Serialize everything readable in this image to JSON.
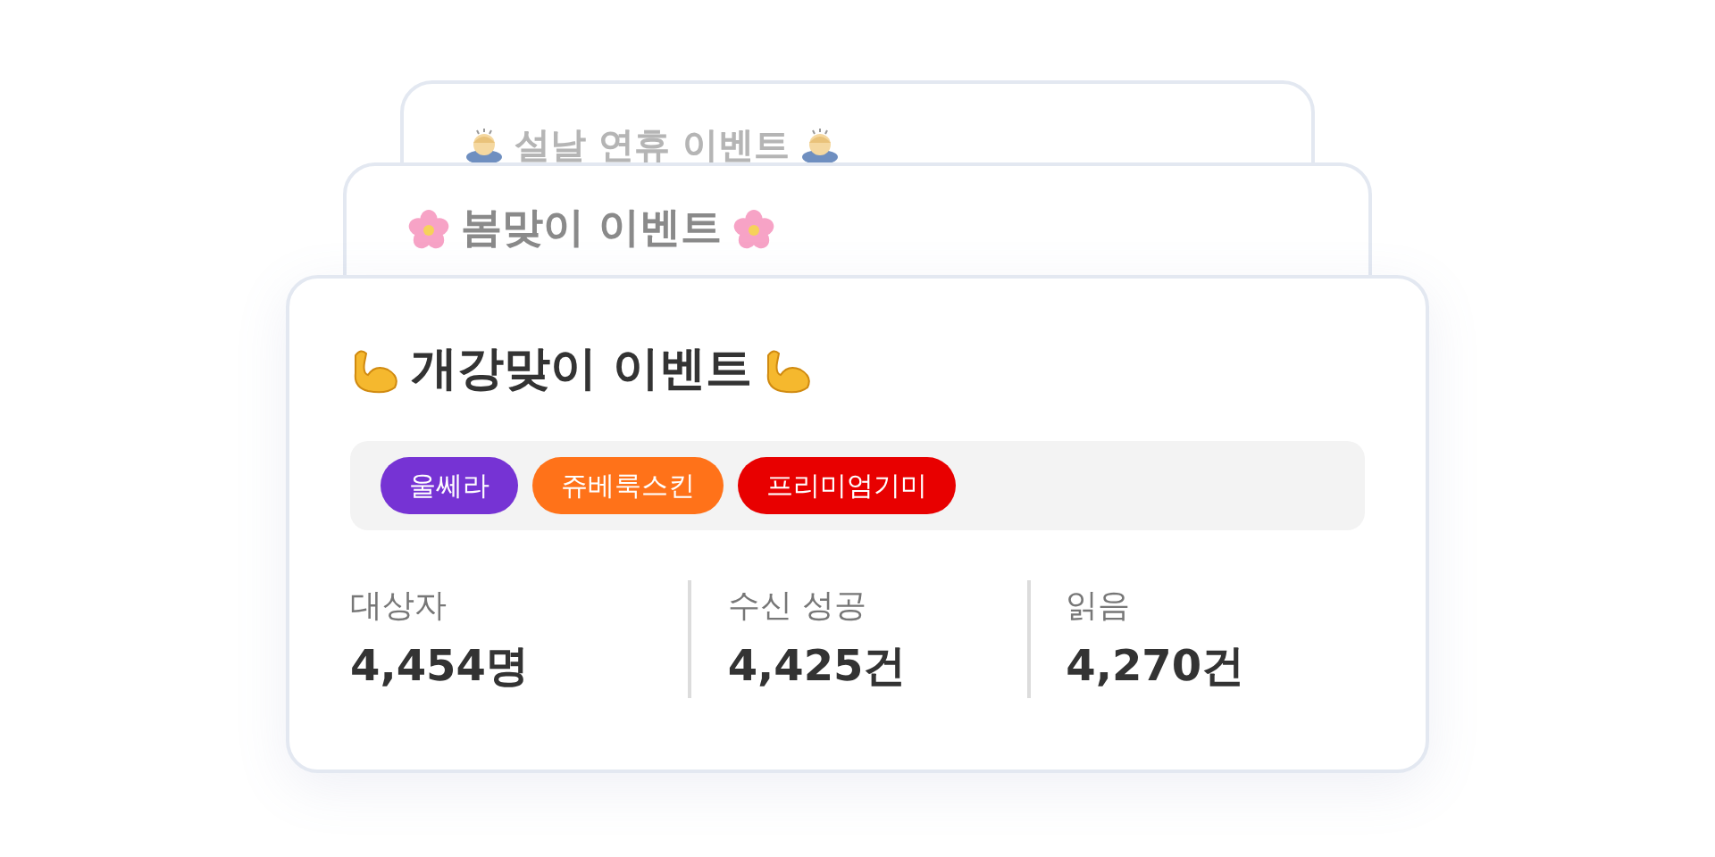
{
  "cards": [
    {
      "title": "설날 연휴 이벤트",
      "kind": "bowing"
    },
    {
      "title": "봄맞이 이벤트",
      "kind": "blossom"
    },
    {
      "title": "개강맞이 이벤트",
      "kind": "muscle",
      "tags": [
        {
          "label": "울쎄라",
          "color": "#7633d4"
        },
        {
          "label": "쥬베룩스킨",
          "color": "#ff7219"
        },
        {
          "label": "프리미엄기미",
          "color": "#e80000"
        }
      ],
      "stats": [
        {
          "label": "대상자",
          "value": "4,454명"
        },
        {
          "label": "수신 성공",
          "value": "4,425건"
        },
        {
          "label": "읽음",
          "value": "4,270건"
        }
      ]
    }
  ]
}
